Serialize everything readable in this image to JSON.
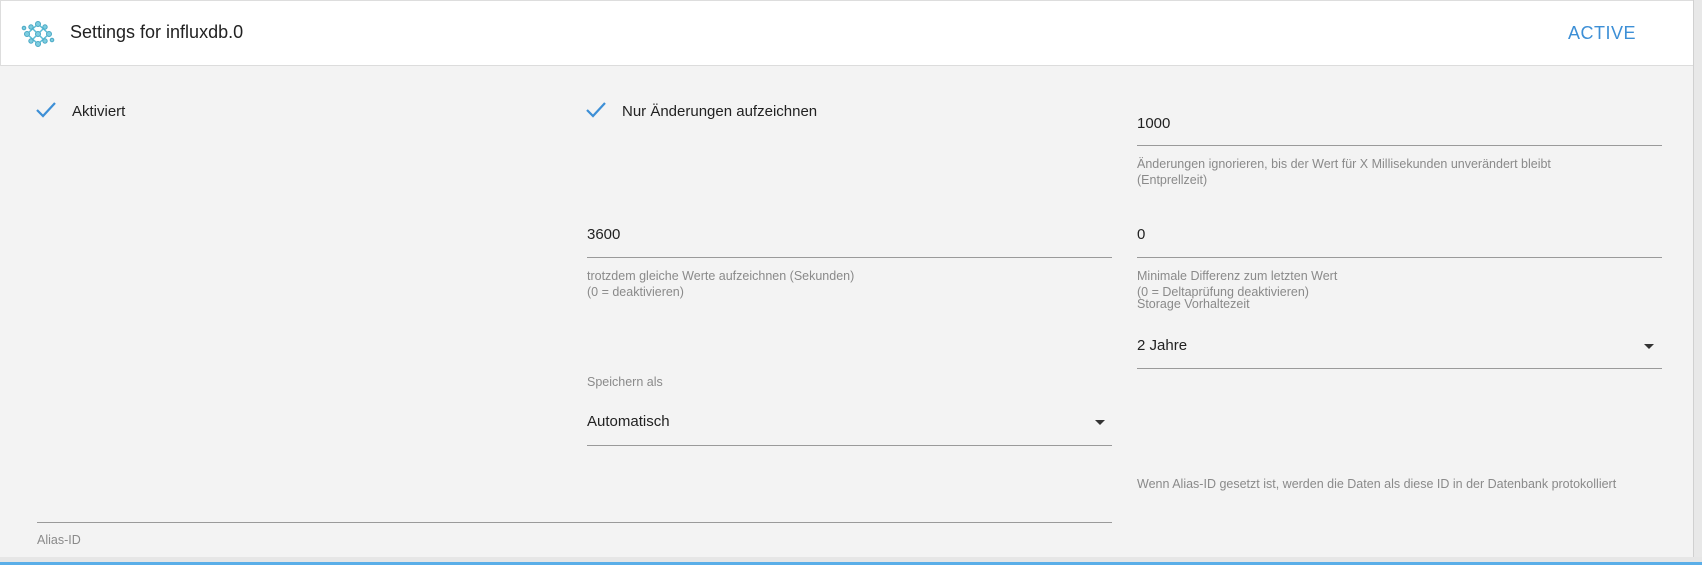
{
  "header": {
    "title": "Settings for influxdb.0",
    "status": "ACTIVE",
    "logo_icon": "influxdb-logo-icon"
  },
  "fields": {
    "enabled": {
      "label": "Aktiviert",
      "checked": true
    },
    "changes_only": {
      "label": "Nur Änderungen aufzeichnen",
      "checked": true
    },
    "debounce": {
      "value": "1000",
      "help_line1": "Änderungen ignorieren, bis der Wert für X Millisekunden unverändert bleibt",
      "help_line2": "(Entprellzeit)"
    },
    "change_interval": {
      "value": "3600",
      "help_line1": "trotzdem gleiche Werte aufzeichnen (Sekunden)",
      "help_line2": "(0 = deaktivieren)"
    },
    "min_diff": {
      "value": "0",
      "help_line1": "Minimale Differenz zum letzten Wert",
      "help_line2": "(0 = Deltaprüfung deaktivieren)"
    },
    "retention": {
      "label": "Storage Vorhaltezeit",
      "value": "2 Jahre"
    },
    "store_as": {
      "label": "Speichern als",
      "value": "Automatisch"
    },
    "alias": {
      "label": "Alias-ID",
      "value": "",
      "help": "Wenn Alias-ID gesetzt ist, werden die Daten als diese ID in der Datenbank protokolliert"
    }
  },
  "colors": {
    "accent": "#3d8fd6",
    "check": "#3d8fd6"
  }
}
